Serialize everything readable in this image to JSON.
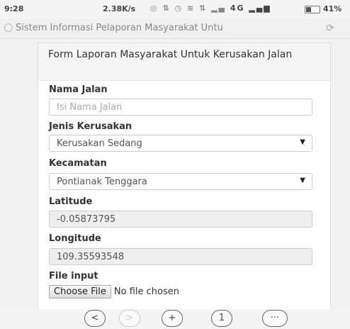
{
  "status_bar": {
    "time": "9:28",
    "speed": "2.38K/s",
    "signal_text": "4G",
    "battery": "41%",
    "battery_level": 0.41
  },
  "browser": {
    "url": "Sistem Informasi Pelaporan Masyarakat Untu"
  },
  "form": {
    "title": "Form Laporan Masyarakat Untuk Kerusakan Jalan",
    "nama_jalan": {
      "label": "Nama Jalan",
      "placeholder": "Isi Nama Jalan",
      "value": ""
    },
    "jenis_kerusakan": {
      "label": "Jenis Kerusakan",
      "selected": "Kerusakan Sedang"
    },
    "kecamatan": {
      "label": "Kecamatan",
      "selected": "Pontianak Tenggara"
    },
    "latitude": {
      "label": "Latitude",
      "value": "-0.05873795"
    },
    "longitude": {
      "label": "Longitude",
      "value": "109.35593548"
    },
    "file_input": {
      "label": "File input",
      "button": "Choose File",
      "status": "No file chosen"
    }
  },
  "nav": {
    "back": "<",
    "forward": ">",
    "new_tab": "+",
    "tabs_count": "1",
    "menu": "···"
  },
  "icons": {
    "dropdown": "caret-down-icon",
    "reload": "reload-icon",
    "site": "site-icon"
  }
}
